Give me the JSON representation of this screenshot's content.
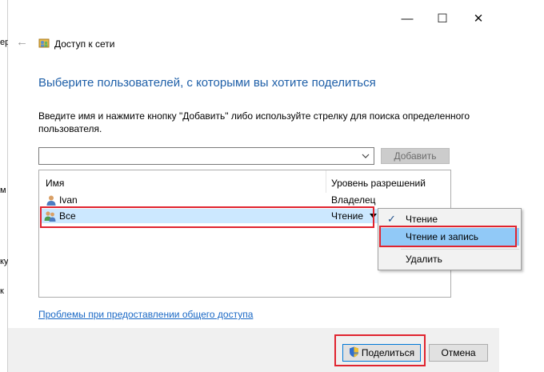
{
  "background_window": {
    "chars": [
      "ер",
      "м",
      "ку",
      "к"
    ]
  },
  "titlebar": {
    "minimize": "—",
    "maximize": "☐",
    "close": "✕"
  },
  "nav": {
    "back_icon": "←",
    "app_title": "Доступ к сети"
  },
  "main": {
    "heading": "Выберите пользователей, с которыми вы хотите поделиться",
    "instructions": "Введите имя и нажмите кнопку \"Добавить\" либо используйте стрелку для поиска определенного пользователя.",
    "name_input": {
      "value": "",
      "placeholder": ""
    },
    "add_button": "Добавить"
  },
  "table": {
    "columns": [
      "Имя",
      "Уровень разрешений"
    ],
    "rows": [
      {
        "name": "Ivan",
        "permission": "Владелец",
        "icon": "user-icon",
        "selected": false
      },
      {
        "name": "Все",
        "permission": "Чтение",
        "icon": "group-icon",
        "selected": true,
        "has_dropdown": true
      }
    ]
  },
  "permission_menu": {
    "items": [
      {
        "label": "Чтение",
        "checked": true
      },
      {
        "label": "Чтение и запись",
        "highlighted": true
      },
      {
        "label": "Удалить"
      }
    ]
  },
  "footer": {
    "help_link": "Проблемы при предоставлении общего доступа",
    "share_button": "Поделиться",
    "cancel_button": "Отмена"
  },
  "colors": {
    "accent": "#1e5fa8",
    "highlight": "#e0242f",
    "selection": "#cce8ff",
    "menu_hover": "#91c9f7",
    "link": "#1a68c5"
  }
}
